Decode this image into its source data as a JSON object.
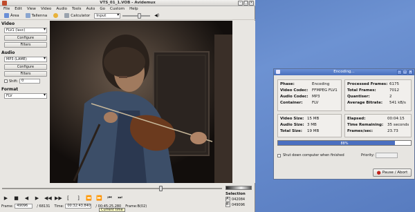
{
  "app": {
    "title": "VTS_01_1.VOB - Avidemux",
    "menu": [
      "File",
      "Edit",
      "View",
      "Video",
      "Audio",
      "Tools",
      "Auto",
      "Go",
      "Custom",
      "Help"
    ],
    "toolbar": {
      "open_label": "Àrea",
      "save_label": "Tallenna",
      "calculator_label": "Calculator",
      "input_select": "Input"
    }
  },
  "left_panel": {
    "video_label": "Video",
    "video_codec": "FLV1 (lavc)",
    "configure_label": "Configure",
    "filters_label": "Filters",
    "audio_label": "Audio",
    "audio_codec": "MP3 (LAME)",
    "audio_configure_label": "Configure",
    "audio_filters_label": "Filters",
    "shift_label": "Shift:",
    "shift_value": "0",
    "format_label": "Format",
    "format_value": "FLV"
  },
  "transport": {
    "seek_position": 0.72,
    "buttons": [
      "play",
      "stop",
      "rewind",
      "forward",
      "prev-keyframe",
      "next-keyframe",
      "mark-a",
      "mark-b",
      "prev-black",
      "next-black",
      "first-frame",
      "last-frame"
    ]
  },
  "selection": {
    "title": "Selection",
    "a_label": "A:",
    "a_value": "042084",
    "b_label": "B:",
    "b_value": "049096"
  },
  "status": {
    "frame_label": "Frame:",
    "frame_value": "49096",
    "frame_total": "/ 68131",
    "time_label": "Time:",
    "time_value": "00:32:43.840",
    "time_total": "/ 00:45:25.280",
    "frame_type": "Frame:B(02)",
    "tooltip": "Current time"
  },
  "dialog": {
    "title": "Encoding...",
    "phase_label": "Phase:",
    "phase_value": "Encoding",
    "video_codec_label": "Video Codec:",
    "video_codec_value": "FFMPEG FLV1",
    "audio_codec_label": "Audio Codec:",
    "audio_codec_value": "MP3",
    "container_label": "Container:",
    "container_value": "FLV",
    "processed_frames_label": "Processed Frames:",
    "processed_frames_value": "6175",
    "total_frames_label": "Total Frames:",
    "total_frames_value": "7012",
    "quantiser_label": "Quantiser:",
    "quantiser_value": "2",
    "avg_bitrate_label": "Average Bitrate:",
    "avg_bitrate_value": "541 kB/s",
    "video_size_label": "Video Size:",
    "video_size_value": "15 MB",
    "audio_size_label": "Audio Size:",
    "audio_size_value": "3 MB",
    "total_size_label": "Total Size:",
    "total_size_value": "19 MB",
    "elapsed_label": "Elapsed:",
    "elapsed_value": "00:04:15",
    "time_remaining_label": "Time Remaining:",
    "time_remaining_value": "35 seconds",
    "fps_label": "Frames/sec:",
    "fps_value": "23.73",
    "progress_percent": 88,
    "progress_text": "88%",
    "shutdown_label": "Shut down computer when finished",
    "priority_label": "Priority:",
    "pause_label": "Pause / Abort"
  },
  "colors": {
    "desktop": "#5b7fc0",
    "window_bg": "#e8e6e2",
    "dialog_title": "#4a70bd",
    "progress_fill": "#4a6fc1"
  }
}
